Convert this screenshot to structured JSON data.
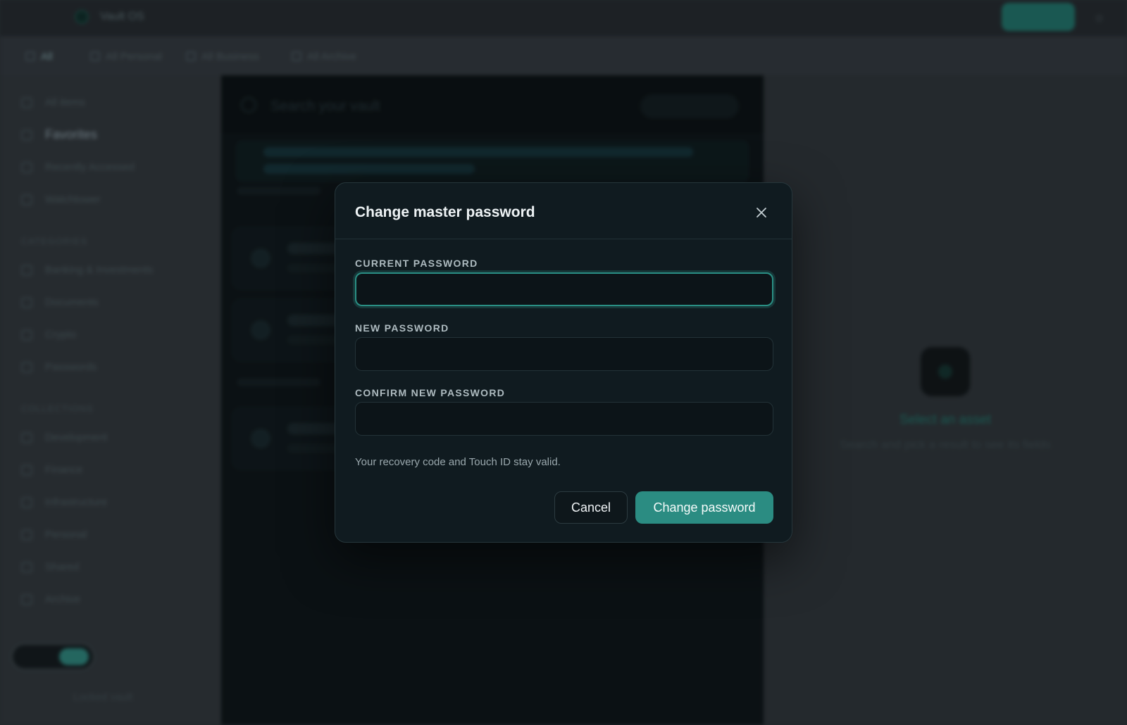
{
  "app": {
    "name": "Vault OS",
    "filters": [
      "All",
      "All Personal",
      "All Business",
      "All Archive"
    ]
  },
  "sidebar": {
    "items": [
      "All items",
      "Favorites",
      "Recently Accessed",
      "Watchtower"
    ],
    "section1_title": "CATEGORIES",
    "categories": [
      "Banking & Investments",
      "Documents",
      "Crypto",
      "Passwords"
    ],
    "section2_title": "COLLECTIONS",
    "collections": [
      "Development",
      "Finance",
      "Infrastructure",
      "Personal",
      "Shared",
      "Archive"
    ],
    "footer": "Locked vault"
  },
  "list": {
    "search_placeholder": "Search your vault"
  },
  "detail": {
    "title": "Select an asset",
    "subtitle": "Search and pick a result to see its fields"
  },
  "modal": {
    "title": "Change master password",
    "current_label": "CURRENT PASSWORD",
    "current_value": "",
    "new_label": "NEW PASSWORD",
    "new_value": "",
    "confirm_label": "CONFIRM NEW PASSWORD",
    "confirm_value": "",
    "hint": "Your recovery code and Touch ID stay valid.",
    "cancel_label": "Cancel",
    "submit_label": "Change password"
  },
  "colors": {
    "accent": "#2b8c82",
    "modal_bg": "#101b20",
    "focus_ring": "#2a8f84"
  }
}
